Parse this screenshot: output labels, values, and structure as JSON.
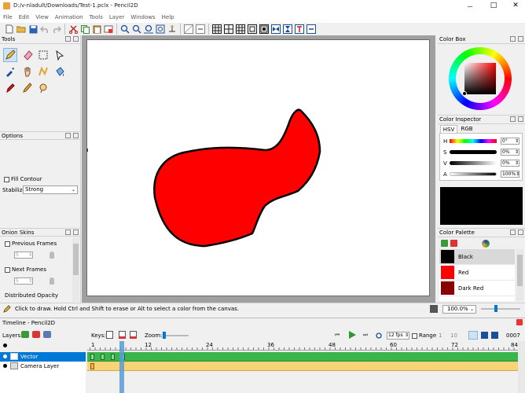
{
  "window": {
    "title": "D:/v-nladult/Downloads/Test-1.pclx - Pencil2D",
    "controls": {
      "minimize": "—",
      "maximize": "□",
      "close": "✕"
    }
  },
  "menu": [
    "File",
    "Edit",
    "View",
    "Animation",
    "Tools",
    "Layer",
    "Windows",
    "Help"
  ],
  "tools_panel": {
    "title": "Tools"
  },
  "options_panel": {
    "title": "Options",
    "fill_contour": "Fill Contour",
    "stabilizer_label": "Stabilizer",
    "stabilizer_value": "Strong"
  },
  "onion_panel": {
    "title": "Onion Skins",
    "previous": "Previous Frames",
    "prev_count": "5",
    "next": "Next Frames",
    "next_count": "5",
    "distributed": "Distributed Opacity"
  },
  "color_box": {
    "title": "Color Box"
  },
  "color_inspector": {
    "title": "Color Inspector",
    "tabs": [
      "HSV",
      "RGB"
    ],
    "rows": [
      {
        "label": "H",
        "value": "0°"
      },
      {
        "label": "S",
        "value": "0%"
      },
      {
        "label": "V",
        "value": "0%"
      },
      {
        "label": "A",
        "value": "100%"
      }
    ]
  },
  "color_palette": {
    "title": "Color Palette",
    "colors": [
      {
        "name": "Black",
        "hex": "#000000"
      },
      {
        "name": "Red",
        "hex": "#ff0000"
      },
      {
        "name": "Dark Red",
        "hex": "#8b0000"
      }
    ]
  },
  "status": {
    "text": "Click to draw. Hold Ctrl and Shift to erase or Alt to select a color from the canvas.",
    "zoom": "100.0%"
  },
  "timeline": {
    "title": "Timeline - Pencil2D",
    "layers_label": "Layers:",
    "keys_label": "Keys:",
    "zoom_label": "Zoom:",
    "fps": "12 fps",
    "range_label": "Range",
    "range_start": "1",
    "range_end": "10",
    "frame": "0007",
    "ruler": [
      "1",
      "12",
      "24",
      "36",
      "48",
      "60",
      "72",
      "84"
    ],
    "layers": [
      {
        "name": "Vector"
      },
      {
        "name": "Camera Layer"
      }
    ]
  },
  "colors": {
    "accent": "#0078d7",
    "shape_fill": "#ff0000",
    "vector_track": "#39b54a",
    "camera_track": "#f8d477",
    "playhead": "#5b9bd5"
  }
}
